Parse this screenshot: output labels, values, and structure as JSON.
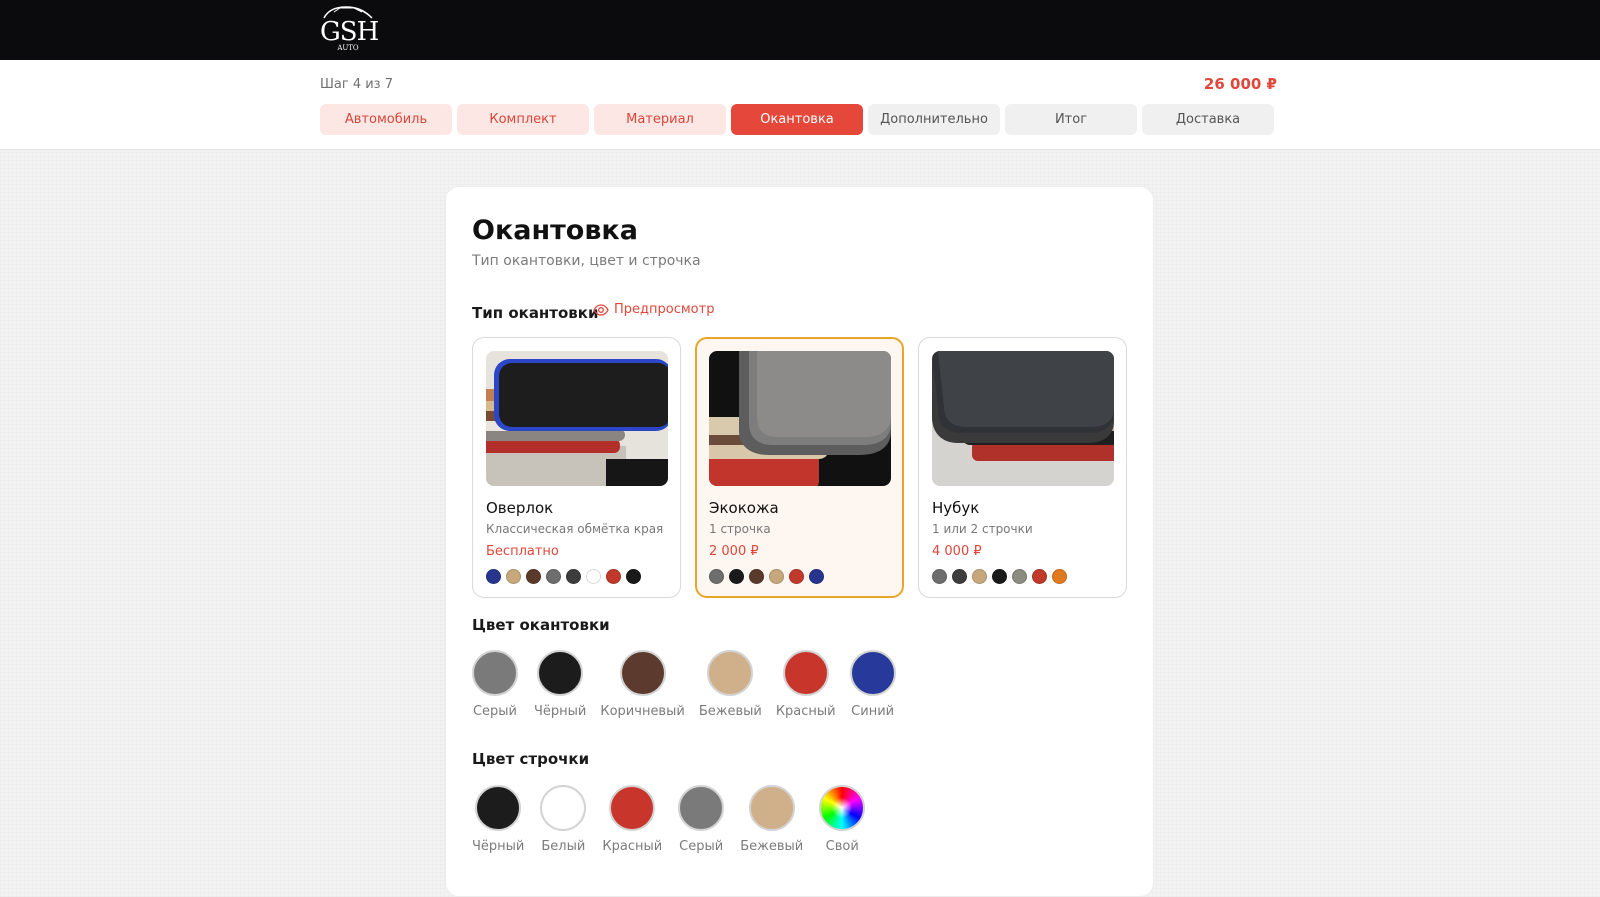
{
  "header": {
    "logo_text": "GSH",
    "logo_sub": "AUTO"
  },
  "stepper": {
    "counter": "Шаг 4 из 7",
    "total": "26 000 ₽",
    "tabs": [
      {
        "label": "Автомобиль",
        "state": "done"
      },
      {
        "label": "Комплект",
        "state": "done"
      },
      {
        "label": "Материал",
        "state": "done"
      },
      {
        "label": "Окантовка",
        "state": "active"
      },
      {
        "label": "Дополнительно",
        "state": "todo"
      },
      {
        "label": "Итог",
        "state": "todo"
      },
      {
        "label": "Доставка",
        "state": "todo"
      }
    ]
  },
  "page": {
    "title": "Окантовка",
    "subtitle": "Тип окантовки, цвет и строчка",
    "type_section": "Тип окантовки",
    "preview": "Предпросмотр",
    "edging_color_section": "Цвет окантовки",
    "stitch_color_section": "Цвет строчки"
  },
  "options": [
    {
      "name": "Оверлок",
      "desc": "Классическая обмётка края",
      "price": "Бесплатно",
      "selected": false,
      "colors": [
        "#27358f",
        "#c6a87c",
        "#5b3a2c",
        "#6e6e6e",
        "#3d3d3d",
        "#ffffff",
        "#c0392b",
        "#1a1a1a"
      ]
    },
    {
      "name": "Экокожа",
      "desc": "1 строчка",
      "price": "2 000 ₽",
      "selected": true,
      "colors": [
        "#6e6e6e",
        "#1a1a1a",
        "#5b3a2c",
        "#c6a87c",
        "#c0392b",
        "#27358f"
      ]
    },
    {
      "name": "Нубук",
      "desc": "1 или 2 строчки",
      "price": "4 000 ₽",
      "selected": false,
      "colors": [
        "#6e6e6e",
        "#3d3d3d",
        "#c6a87c",
        "#1a1a1a",
        "#8c8c80",
        "#c0392b",
        "#e07a1f"
      ]
    }
  ],
  "edging_colors": [
    {
      "label": "Серый",
      "color": "#7a7a7a"
    },
    {
      "label": "Чёрный",
      "color": "#1c1c1c"
    },
    {
      "label": "Коричневый",
      "color": "#5c3a2d"
    },
    {
      "label": "Бежевый",
      "color": "#cfb08b"
    },
    {
      "label": "Красный",
      "color": "#c8352a"
    },
    {
      "label": "Синий",
      "color": "#27399a"
    }
  ],
  "stitch_colors": [
    {
      "label": "Чёрный",
      "color": "#1c1c1c"
    },
    {
      "label": "Белый",
      "color": "#ffffff"
    },
    {
      "label": "Красный",
      "color": "#c8352a"
    },
    {
      "label": "Серый",
      "color": "#7a7a7a"
    },
    {
      "label": "Бежевый",
      "color": "#cfb08b"
    },
    {
      "label": "Свой",
      "color": "rainbow"
    }
  ]
}
